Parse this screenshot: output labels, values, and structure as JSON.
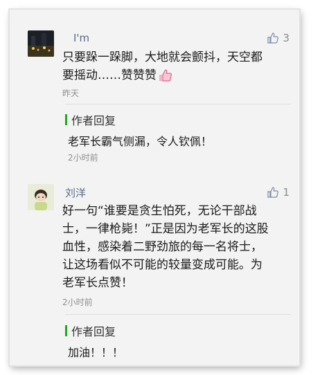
{
  "comments": [
    {
      "username": "I'm",
      "likes": "3",
      "text_lines": [
        "只要跺一跺脚，大地就会颤抖，天空都",
        "要摇动……赞赞赞"
      ],
      "time": "昨天",
      "reply_label": "作者回复",
      "reply_text": "老军长霸气侧漏，令人钦佩！",
      "reply_time": "2小时前"
    },
    {
      "username": "刘洋",
      "likes": "1",
      "text_lines": [
        "好一句“谁要是贪生怕死，无论干部战",
        "士，一律枪毙！”正是因为老军长的这股",
        "血性，感染着二野劲旅的每一名将士，",
        "让这场看似不可能的较量变成可能。为",
        "老军长点赞！"
      ],
      "time": "2小时前",
      "reply_label": "作者回复",
      "reply_text": "加油！！！"
    }
  ],
  "colors": {
    "accent_green": "#1aad19",
    "username": "#5b6b86"
  }
}
